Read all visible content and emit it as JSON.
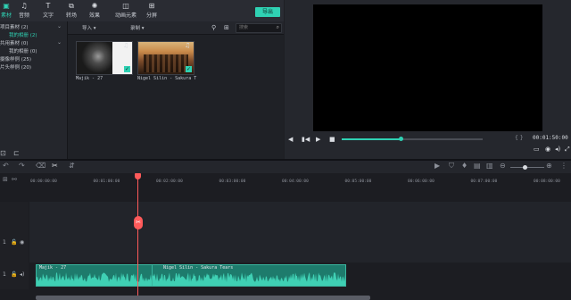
{
  "toolbar": {
    "tabs": [
      {
        "label": "素材",
        "icon": "media-icon"
      },
      {
        "label": "音频",
        "icon": "music-note-icon"
      },
      {
        "label": "文字",
        "icon": "text-icon"
      },
      {
        "label": "转场",
        "icon": "transition-icon"
      },
      {
        "label": "效果",
        "icon": "effects-icon"
      },
      {
        "label": "动画元素",
        "icon": "elements-icon"
      },
      {
        "label": "分屏",
        "icon": "split-screen-icon"
      }
    ],
    "export_label": "导出"
  },
  "tree": {
    "items": [
      {
        "label": "项目素材 (2)",
        "selected": false
      },
      {
        "label": "我的相册 (2)",
        "selected": true
      },
      {
        "label": "共用素材 (0)",
        "selected": false
      },
      {
        "label": "我的相册 (0)",
        "selected": false
      },
      {
        "label": "摄像样例 (25)",
        "selected": false
      },
      {
        "label": "片头样例 (20)",
        "selected": false
      }
    ]
  },
  "media_toolbar": {
    "import_label": "导入",
    "record_label": "录制",
    "search_placeholder": "搜索"
  },
  "media_items": [
    {
      "name": "Majik - 27",
      "type": "audio"
    },
    {
      "name": "Nigel Silin - Sakura T",
      "type": "audio"
    }
  ],
  "player": {
    "progress": 0.42,
    "timecode": "00:01:50:00"
  },
  "timeline": {
    "ruler_ticks": [
      "00:00:00:00",
      "00:01:00:00",
      "00:02:00:00",
      "00:03:00:00",
      "00:04:00:00",
      "00:05:00:00",
      "00:06:00:00",
      "00:07:00:00",
      "00:08:00:00"
    ],
    "clips": [
      {
        "label": "Majik - 27"
      },
      {
        "label": "Nigel Silin - Sakura Tears"
      }
    ]
  },
  "colors": {
    "accent": "#2fd1b3",
    "playhead": "#ff5a5a",
    "clip": "#1e7b6c"
  }
}
